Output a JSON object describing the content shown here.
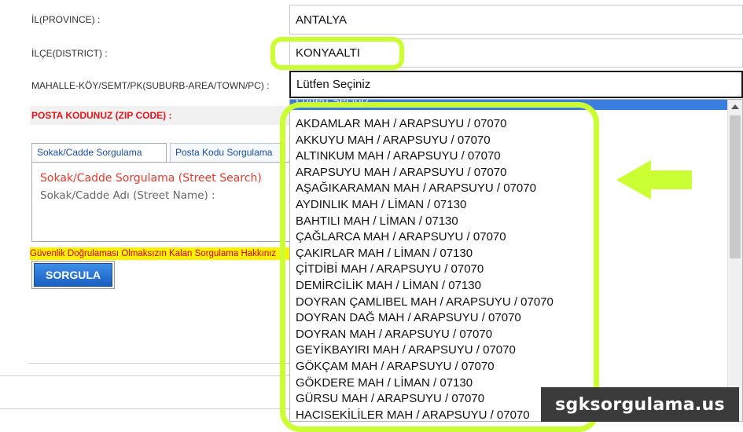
{
  "form": {
    "province_label": "İL(PROVINCE) :",
    "province_value": "ANTALYA",
    "district_label": "İLÇE(DISTRICT) :",
    "district_value": "KONYAALTI",
    "suburb_label": "MAHALLE-KÖY/SEMT/PK(SUBURB-AREA/TOWN/PC) :",
    "suburb_value": "Lütfen Seçiniz",
    "zip_label": "POSTA KODUNUZ (ZIP CODE) :"
  },
  "tabs": [
    {
      "label": "Sokak/Cadde Sorgulama"
    },
    {
      "label": "Posta Kodu Sorgulama"
    }
  ],
  "panel": {
    "title": "Sokak/Cadde Sorgulama (Street Search)",
    "street_label": "Sokak/Cadde Adı (Street Name) :"
  },
  "warning": "Güvenlik Doğrulaması Olmaksızın Kalan Sorgulama Hakkınız",
  "query_button": "SORGULA",
  "dropdown": {
    "selected": "Lütfen Seçiniz",
    "options": [
      "AKDAMLAR MAH / ARAPSUYU / 07070",
      "AKKUYU MAH / ARAPSUYU / 07070",
      "ALTINKUM MAH / ARAPSUYU / 07070",
      "ARAPSUYU MAH / ARAPSUYU / 07070",
      "AŞAĞIKARAMAN MAH / ARAPSUYU / 07070",
      "AYDINLIK MAH / LİMAN / 07130",
      "BAHTILI MAH / LİMAN / 07130",
      "ÇAĞLARCA MAH / ARAPSUYU / 07070",
      "ÇAKIRLAR MAH / LİMAN / 07130",
      "ÇİTDİBİ MAH / ARAPSUYU / 07070",
      "DEMİRCİLİK MAH / LİMAN / 07130",
      "DOYRAN ÇAMLIBEL MAH / ARAPSUYU / 07070",
      "DOYRAN DAĞ MAH / ARAPSUYU / 07070",
      "DOYRAN MAH / ARAPSUYU / 07070",
      "GEYİKBAYIRI MAH / ARAPSUYU / 07070",
      "GÖKÇAM MAH / ARAPSUYU / 07070",
      "GÖKDERE MAH / LİMAN / 07130",
      "GÜRSU MAH / ARAPSUYU / 07070",
      "HACISEKİLİLER MAH / ARAPSUYU / 07070"
    ]
  },
  "annotation": {
    "highlight_color": "#ccff33",
    "arrow_icon": "arrow-left-icon"
  },
  "watermark": "sgksorgulama.us"
}
